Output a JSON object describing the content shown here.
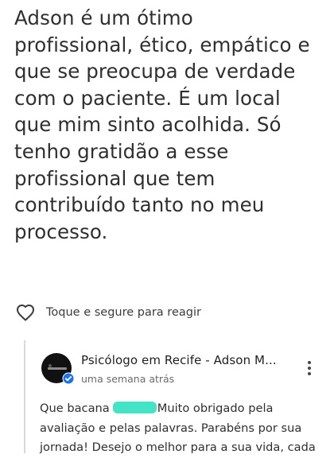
{
  "review": {
    "lines": [
      "Adson é um ótimo",
      "profissional, ético, empático e",
      "que se preocupa de verdade",
      "com o paciente. É um local",
      "que mim sinto acolhida. Só",
      "tenho gratidão a esse",
      "profissional que tem",
      "contribuído tanto no meu",
      "processo."
    ]
  },
  "reaction": {
    "icon": "heart-outline-icon",
    "label": "Toque e segure para reagir"
  },
  "owner_reply": {
    "name": "Psicólogo em Recife - Adson M...",
    "time": "uma semana atrás",
    "verified_icon": "verified-badge-icon",
    "verified_color": "#1a73e8",
    "redaction_color": "#45e3c6",
    "text_line1_before": "Que bacana",
    "text_line1_after": "Muito obrigado pela",
    "text_line2": "avaliação e pelas palavras. Parabéns por sua",
    "text_line3": "jornada! Desejo o melhor para a sua vida, cada"
  }
}
